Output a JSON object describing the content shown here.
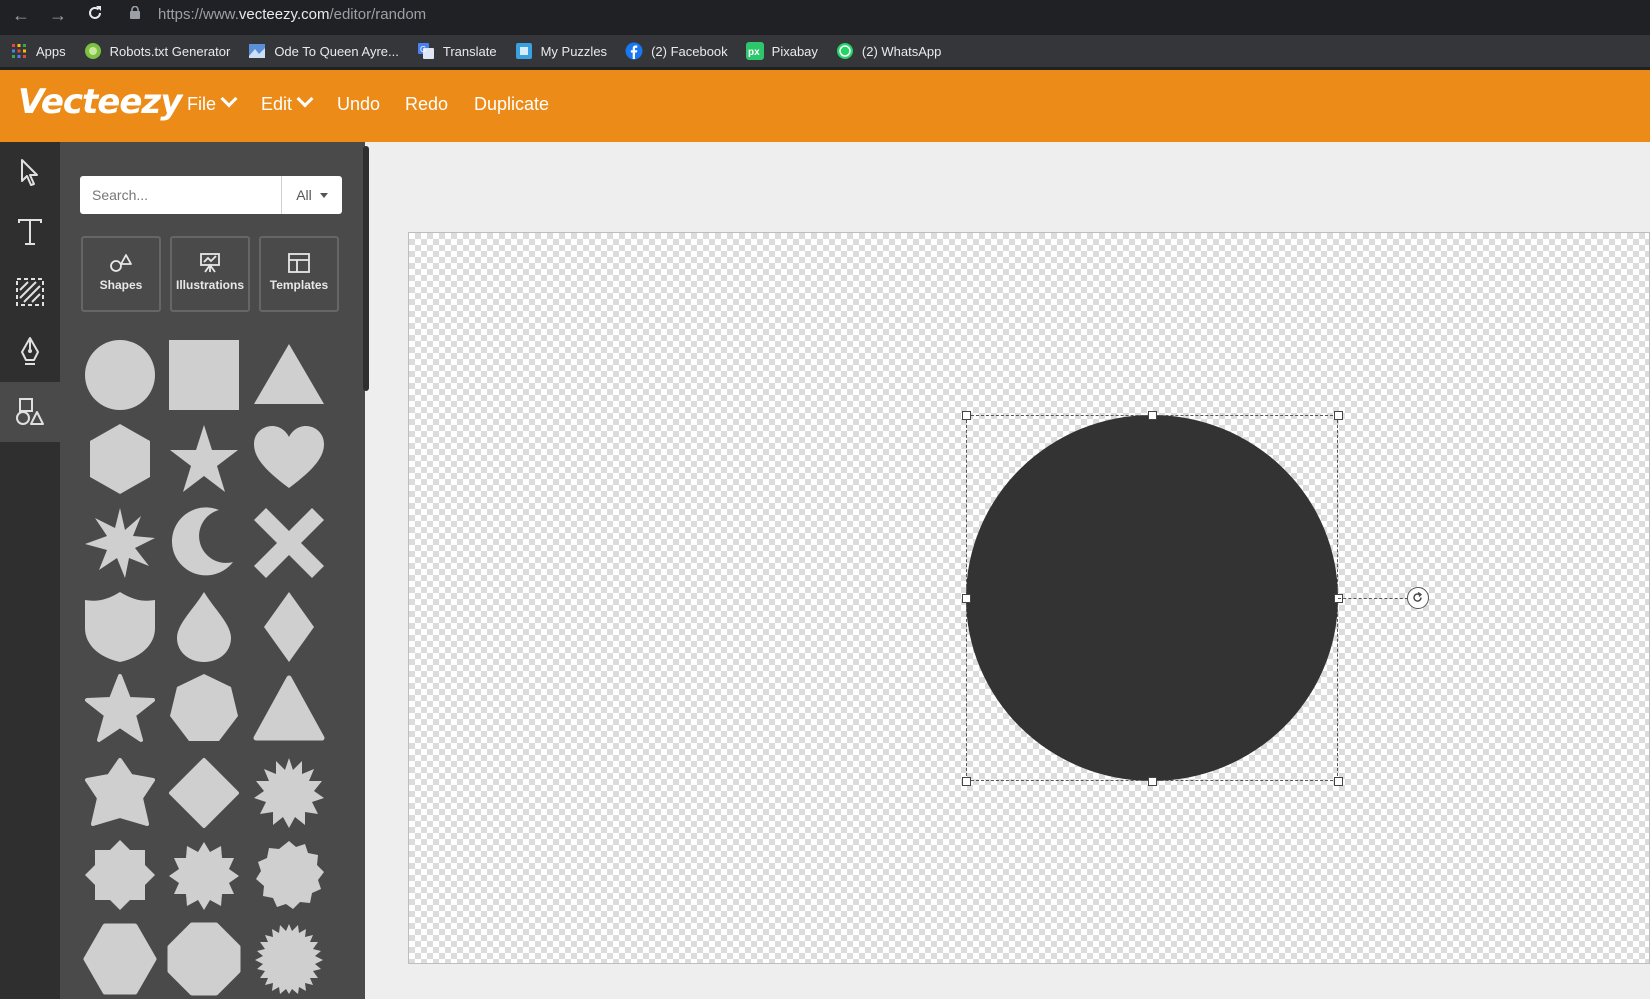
{
  "browser": {
    "url_prefix": "https://www.",
    "url_host": "vecteezy.com",
    "url_path": "/editor/random",
    "bookmarks": [
      {
        "label": "Apps",
        "icon": "apps-grid-icon",
        "color": "#e8453c"
      },
      {
        "label": "Robots.txt Generator",
        "icon": "robots-icon",
        "color": "#7cc142"
      },
      {
        "label": "Ode To Queen Ayre...",
        "icon": "ode-icon",
        "color": "#5b8fd9"
      },
      {
        "label": "Translate",
        "icon": "translate-icon",
        "color": "#4a80f0"
      },
      {
        "label": "My Puzzles",
        "icon": "puzzle-icon",
        "color": "#3aa0e0"
      },
      {
        "label": "(2) Facebook",
        "icon": "facebook-icon",
        "color": "#1877f2"
      },
      {
        "label": "Pixabay",
        "icon": "pixabay-icon",
        "color": "#2ec66d"
      },
      {
        "label": "(2) WhatsApp",
        "icon": "whatsapp-icon",
        "color": "#25d366"
      }
    ]
  },
  "app": {
    "logo": "Vecteezy",
    "accent": "#ec8b18",
    "menu": {
      "file": "File",
      "edit": "Edit",
      "undo": "Undo",
      "redo": "Redo",
      "duplicate": "Duplicate"
    }
  },
  "tools": [
    "select-tool",
    "text-tool",
    "pattern-tool",
    "pen-tool",
    "shapes-tool"
  ],
  "panel": {
    "search_placeholder": "Search...",
    "filter_value": "All",
    "categories": {
      "shapes": "Shapes",
      "illustrations": "Illustrations",
      "templates": "Templates"
    }
  },
  "canvas": {
    "selected_shape": "circle",
    "shape_color": "#333333"
  }
}
